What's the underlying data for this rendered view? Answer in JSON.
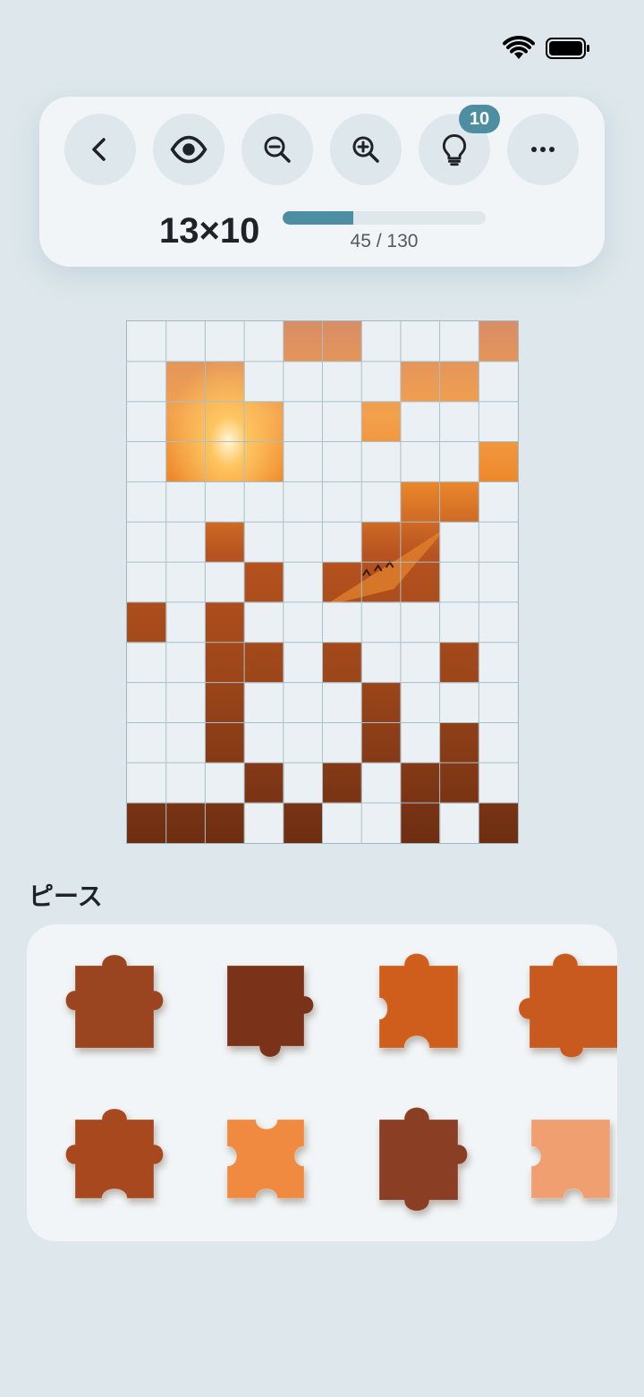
{
  "status": {
    "wifi_icon": "wifi-icon",
    "battery_icon": "battery-full-icon"
  },
  "toolbar": {
    "buttons": [
      {
        "name": "back-button",
        "icon": "chevron-left-icon"
      },
      {
        "name": "preview-button",
        "icon": "eye-icon"
      },
      {
        "name": "zoom-out-button",
        "icon": "zoom-out-icon"
      },
      {
        "name": "zoom-in-button",
        "icon": "zoom-in-icon"
      },
      {
        "name": "hint-button",
        "icon": "lightbulb-icon"
      },
      {
        "name": "more-button",
        "icon": "more-horizontal-icon"
      }
    ],
    "hint_count": "10",
    "grid_size": "13×10",
    "progress_text": "45 / 130",
    "progress_fraction": 0.346
  },
  "board": {
    "rows": 13,
    "cols": 10,
    "placed_cells": [
      [
        0,
        4
      ],
      [
        0,
        5
      ],
      [
        0,
        9
      ],
      [
        1,
        1
      ],
      [
        1,
        2
      ],
      [
        1,
        7
      ],
      [
        1,
        8
      ],
      [
        2,
        1
      ],
      [
        2,
        2
      ],
      [
        2,
        3
      ],
      [
        2,
        6
      ],
      [
        3,
        1
      ],
      [
        3,
        2
      ],
      [
        3,
        3
      ],
      [
        3,
        9
      ],
      [
        4,
        7
      ],
      [
        4,
        8
      ],
      [
        5,
        2
      ],
      [
        5,
        6
      ],
      [
        5,
        7
      ],
      [
        6,
        3
      ],
      [
        6,
        5
      ],
      [
        6,
        6
      ],
      [
        6,
        7
      ],
      [
        7,
        0
      ],
      [
        7,
        2
      ],
      [
        8,
        2
      ],
      [
        8,
        3
      ],
      [
        8,
        5
      ],
      [
        8,
        8
      ],
      [
        9,
        2
      ],
      [
        9,
        6
      ],
      [
        10,
        2
      ],
      [
        10,
        6
      ],
      [
        10,
        8
      ],
      [
        11,
        3
      ],
      [
        11,
        5
      ],
      [
        11,
        7
      ],
      [
        11,
        8
      ],
      [
        12,
        0
      ],
      [
        12,
        1
      ],
      [
        12,
        2
      ],
      [
        12,
        4
      ],
      [
        12,
        7
      ],
      [
        12,
        9
      ]
    ]
  },
  "tray": {
    "title": "ピース",
    "pieces": [
      {
        "name": "tray-piece-1",
        "tone": "#9a4420"
      },
      {
        "name": "tray-piece-2",
        "tone": "#7a3218"
      },
      {
        "name": "tray-piece-3",
        "tone": "#cf5e1c"
      },
      {
        "name": "tray-piece-4",
        "tone": "#c85a20"
      },
      {
        "name": "tray-piece-5",
        "tone": "#a8481e"
      },
      {
        "name": "tray-piece-6",
        "tone": "#f08a40"
      },
      {
        "name": "tray-piece-7",
        "tone": "#8a3e24"
      },
      {
        "name": "tray-piece-8",
        "tone": "#f0a070"
      }
    ]
  }
}
